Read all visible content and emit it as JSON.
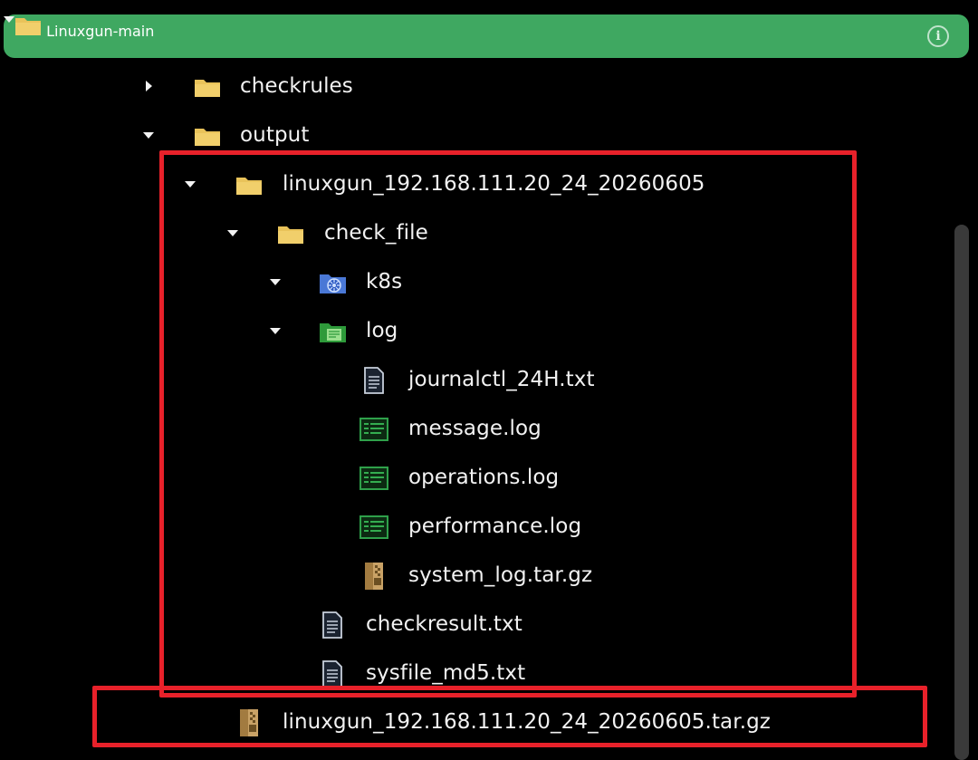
{
  "tree": {
    "root": {
      "label": "Linuxgun-main",
      "expanded": true,
      "info_icon": "info-icon"
    },
    "items": [
      {
        "label": "checkrules",
        "icon": "folder-icon",
        "expanded": false
      },
      {
        "label": "output",
        "icon": "folder-icon",
        "expanded": true
      },
      {
        "label": "linuxgun_192.168.111.20_24_20260605",
        "icon": "folder-icon",
        "expanded": true
      },
      {
        "label": "check_file",
        "icon": "folder-icon",
        "expanded": true
      },
      {
        "label": "k8s",
        "icon": "kubernetes-folder-icon",
        "expanded": true
      },
      {
        "label": "log",
        "icon": "log-folder-icon",
        "expanded": true
      },
      {
        "label": "journalctl_24H.txt",
        "icon": "text-file-icon"
      },
      {
        "label": "message.log",
        "icon": "log-file-icon"
      },
      {
        "label": "operations.log",
        "icon": "log-file-icon"
      },
      {
        "label": "performance.log",
        "icon": "log-file-icon"
      },
      {
        "label": "system_log.tar.gz",
        "icon": "archive-file-icon"
      },
      {
        "label": "checkresult.txt",
        "icon": "text-file-icon"
      },
      {
        "label": "sysfile_md5.txt",
        "icon": "text-file-icon"
      },
      {
        "label": "linuxgun_192.168.111.20_24_20260605.tar.gz",
        "icon": "archive-file-icon"
      }
    ]
  },
  "colors": {
    "background": "#000000",
    "root_highlight": "#3fa861",
    "annotation_box": "#e8212a",
    "folder": "#e9c35a",
    "log_icon": "#2e9a3a",
    "k8s_icon": "#4a78d6",
    "text": "#f2f2f2"
  }
}
